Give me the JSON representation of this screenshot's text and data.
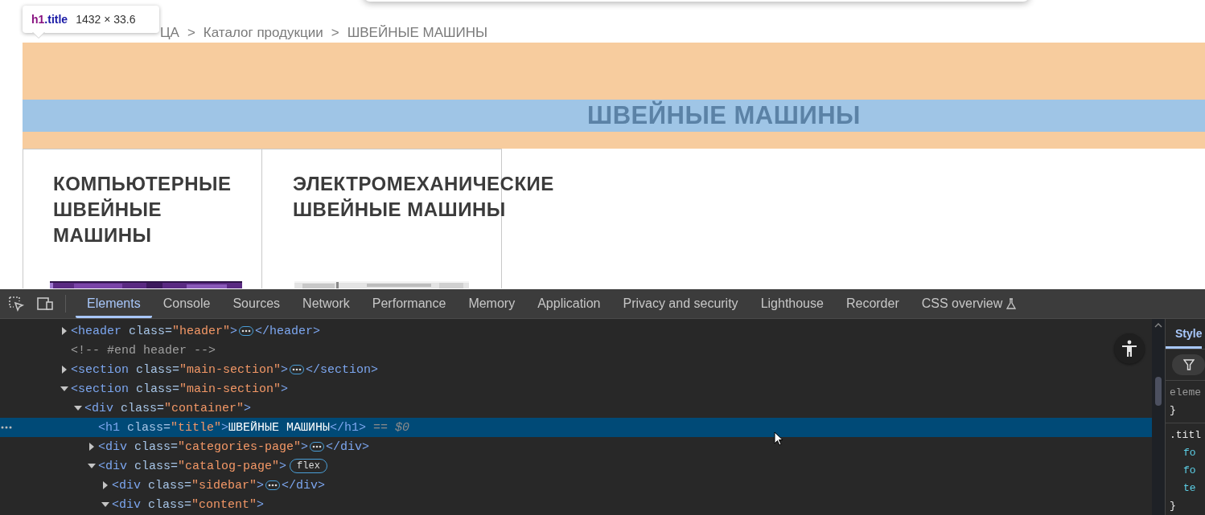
{
  "tooltip": {
    "element": "h1",
    "class_name": ".title",
    "size": "1432 × 33.6"
  },
  "breadcrumb": [
    {
      "label": "ЦА"
    },
    {
      "label": "Каталог продукции"
    },
    {
      "label": "ШВЕЙНЫЕ МАШИНЫ"
    }
  ],
  "breadcrumb_separator": ">",
  "page_title": "ШВЕЙНЫЕ МАШИНЫ",
  "categories": [
    {
      "title": "КОМПЬЮТЕРНЫЕ ШВЕЙНЫЕ МАШИНЫ",
      "kind": "picture"
    },
    {
      "title": "ЭЛЕКТРОМЕХАНИЧЕСКИЕ ШВЕЙНЫЕ МАШИНЫ",
      "kind": "picture"
    }
  ],
  "devtools": {
    "tabs": [
      {
        "label": "Elements",
        "selected": true
      },
      {
        "label": "Console",
        "selected": false
      },
      {
        "label": "Sources",
        "selected": false
      },
      {
        "label": "Network",
        "selected": false
      },
      {
        "label": "Performance",
        "selected": false
      },
      {
        "label": "Memory",
        "selected": false
      },
      {
        "label": "Application",
        "selected": false
      },
      {
        "label": "Privacy and security",
        "selected": false
      },
      {
        "label": "Lighthouse",
        "selected": false
      },
      {
        "label": "Recorder",
        "selected": false
      },
      {
        "label": "CSS overview",
        "selected": false,
        "experimental": true
      }
    ],
    "tree": [
      {
        "expanded": false,
        "selected": false,
        "tokens": [
          {
            "kind": "tag",
            "text": "<header"
          },
          {
            "kind": "attr",
            "text": " class="
          },
          {
            "kind": "value",
            "text": "\"header\""
          },
          {
            "kind": "tag",
            "text": ">"
          },
          {
            "kind": "ellipsis"
          },
          {
            "kind": "tag",
            "text": "</header>"
          }
        ]
      },
      {
        "selected": false,
        "tokens": [
          {
            "kind": "comment",
            "text": "<!-- #end header -->"
          }
        ]
      },
      {
        "expanded": false,
        "selected": false,
        "tokens": [
          {
            "kind": "tag",
            "text": "<section"
          },
          {
            "kind": "attr",
            "text": " class="
          },
          {
            "kind": "value",
            "text": "\"main-section\""
          },
          {
            "kind": "tag",
            "text": ">"
          },
          {
            "kind": "ellipsis"
          },
          {
            "kind": "tag",
            "text": "</section>"
          }
        ]
      },
      {
        "expanded": true,
        "selected": false,
        "tokens": [
          {
            "kind": "tag",
            "text": "<section"
          },
          {
            "kind": "attr",
            "text": " class="
          },
          {
            "kind": "value",
            "text": "\"main-section\""
          },
          {
            "kind": "tag",
            "text": ">"
          }
        ],
        "children": [
          {
            "expanded": true,
            "selected": false,
            "tokens": [
              {
                "kind": "tag",
                "text": "<div"
              },
              {
                "kind": "attr",
                "text": " class="
              },
              {
                "kind": "value",
                "text": "\"container\""
              },
              {
                "kind": "tag",
                "text": ">"
              }
            ],
            "children": [
              {
                "selected": true,
                "tokens": [
                  {
                    "kind": "tag",
                    "text": "<h1"
                  },
                  {
                    "kind": "attr",
                    "text": " class="
                  },
                  {
                    "kind": "value",
                    "text": "\"title\""
                  },
                  {
                    "kind": "tag",
                    "text": ">"
                  },
                  {
                    "kind": "text",
                    "text": "ШВЕЙНЫЕ МАШИНЫ"
                  },
                  {
                    "kind": "tag",
                    "text": "</h1>"
                  },
                  {
                    "kind": "hint",
                    "text": " == $0"
                  }
                ]
              },
              {
                "expanded": false,
                "selected": false,
                "tokens": [
                  {
                    "kind": "tag",
                    "text": "<div"
                  },
                  {
                    "kind": "attr",
                    "text": " class="
                  },
                  {
                    "kind": "value",
                    "text": "\"categories-page\""
                  },
                  {
                    "kind": "tag",
                    "text": ">"
                  },
                  {
                    "kind": "ellipsis"
                  },
                  {
                    "kind": "tag",
                    "text": "</div>"
                  }
                ]
              },
              {
                "expanded": true,
                "selected": false,
                "tokens": [
                  {
                    "kind": "tag",
                    "text": "<div"
                  },
                  {
                    "kind": "attr",
                    "text": " class="
                  },
                  {
                    "kind": "value",
                    "text": "\"catalog-page\""
                  },
                  {
                    "kind": "tag",
                    "text": ">"
                  },
                  {
                    "kind": "pill",
                    "text": "flex"
                  }
                ],
                "children": [
                  {
                    "expanded": false,
                    "selected": false,
                    "tokens": [
                      {
                        "kind": "tag",
                        "text": "<div"
                      },
                      {
                        "kind": "attr",
                        "text": " class="
                      },
                      {
                        "kind": "value",
                        "text": "\"sidebar\""
                      },
                      {
                        "kind": "tag",
                        "text": ">"
                      },
                      {
                        "kind": "ellipsis"
                      },
                      {
                        "kind": "tag",
                        "text": "</div>"
                      }
                    ]
                  },
                  {
                    "expanded": true,
                    "selected": false,
                    "tokens": [
                      {
                        "kind": "tag",
                        "text": "<div"
                      },
                      {
                        "kind": "attr",
                        "text": " class="
                      },
                      {
                        "kind": "value",
                        "text": "\"content\""
                      },
                      {
                        "kind": "tag",
                        "text": ">"
                      }
                    ]
                  }
                ]
              }
            ]
          }
        ]
      }
    ],
    "styles_pane": {
      "tab": "Style",
      "lines": [
        {
          "kind": "muted",
          "text": "eleme"
        },
        {
          "kind": "brace",
          "text": "}"
        },
        {
          "kind": "selector",
          "text": ".titl"
        },
        {
          "kind": "property",
          "text": "fo"
        },
        {
          "kind": "property",
          "text": "fo"
        },
        {
          "kind": "property",
          "text": "te"
        },
        {
          "kind": "brace",
          "text": "}"
        }
      ]
    }
  }
}
